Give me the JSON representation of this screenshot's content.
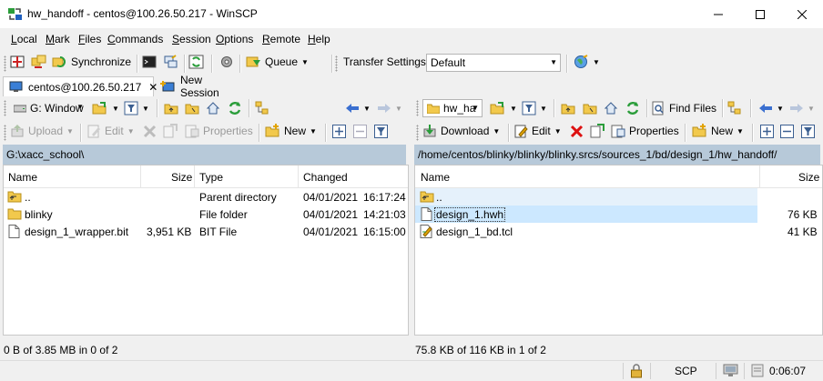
{
  "window": {
    "title": "hw_handoff - centos@100.26.50.217 - WinSCP"
  },
  "menu": {
    "items": [
      {
        "hot": "L",
        "rest": "ocal"
      },
      {
        "hot": "M",
        "rest": "ark"
      },
      {
        "hot": "F",
        "rest": "iles"
      },
      {
        "hot": "C",
        "rest": "ommands"
      },
      {
        "hot": "S",
        "rest": "ession"
      },
      {
        "hot": "O",
        "rest": "ptions"
      },
      {
        "hot": "R",
        "rest": "emote"
      },
      {
        "hot": "H",
        "rest": "elp"
      }
    ]
  },
  "toolbar": {
    "synchronize_label": "Synchronize",
    "queue_label": "Queue",
    "transfer_settings_label": "Transfer Settings",
    "transfer_settings_value": "Default"
  },
  "tabs": {
    "session_label": "centos@100.26.50.217",
    "new_session_label": "New Session"
  },
  "left": {
    "drive_label": "G: Window",
    "upload_label": "Upload",
    "edit_label": "Edit",
    "properties_label": "Properties",
    "new_label": "New",
    "path": "G:\\xacc_school\\",
    "columns": {
      "name": "Name",
      "size": "Size",
      "type": "Type",
      "changed": "Changed"
    },
    "rows": [
      {
        "name": "..",
        "size": "",
        "type": "Parent directory",
        "date": "04/01/2021",
        "time": "16:17:24",
        "icon": "parent-folder-icon"
      },
      {
        "name": "blinky",
        "size": "",
        "type": "File folder",
        "date": "04/01/2021",
        "time": "14:21:03",
        "icon": "folder-icon"
      },
      {
        "name": "design_1_wrapper.bit",
        "size": "3,951 KB",
        "type": "BIT File",
        "date": "04/01/2021",
        "time": "16:15:00",
        "icon": "file-icon"
      }
    ],
    "status": "0 B of 3.85 MB in 0 of 2"
  },
  "right": {
    "dir_label": "hw_ha",
    "download_label": "Download",
    "edit_label": "Edit",
    "properties_label": "Properties",
    "new_label": "New",
    "find_files_label": "Find Files",
    "path": "/home/centos/blinky/blinky/blinky.srcs/sources_1/bd/design_1/hw_handoff/",
    "columns": {
      "name": "Name",
      "size": "Size"
    },
    "rows": [
      {
        "name": "..",
        "size": "",
        "icon": "parent-folder-icon"
      },
      {
        "name": "design_1.hwh",
        "size": "76 KB",
        "icon": "file-icon"
      },
      {
        "name": "design_1_bd.tcl",
        "size": "41 KB",
        "icon": "script-file-icon"
      }
    ],
    "status": "75.8 KB of 116 KB in 1 of 2"
  },
  "bottom": {
    "protocol": "SCP",
    "elapsed": "0:06:07"
  }
}
